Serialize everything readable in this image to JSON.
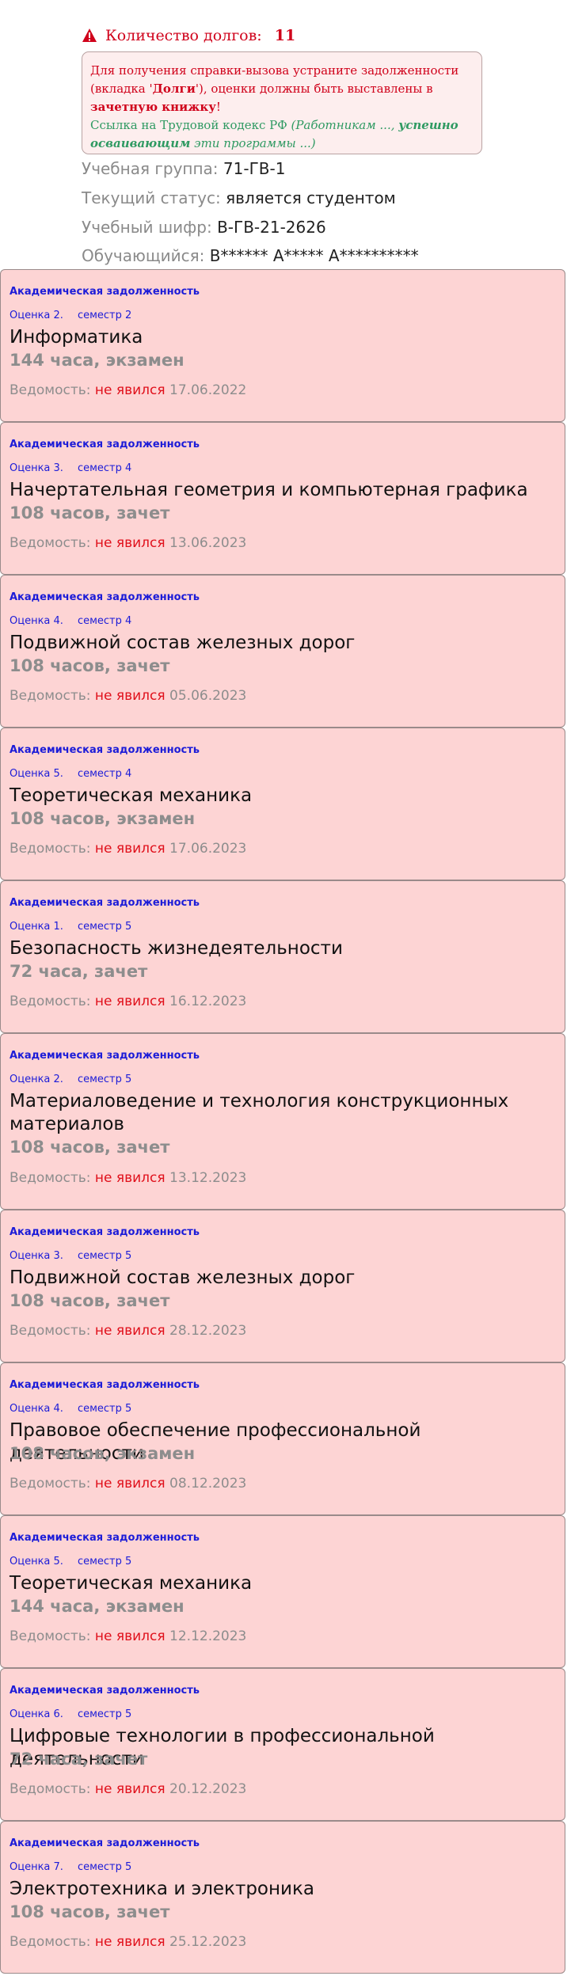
{
  "debts": {
    "label": "Количество долгов:",
    "count": "11"
  },
  "notice": {
    "line1": "Для получения справки-вызова устраните задолженности",
    "line2_pre": "(вкладка '",
    "line2_bold": "Долги",
    "line2_post": "'), оценки должны быть выставлены в",
    "line3_bold": "зачетную книжку",
    "line3_post": "!",
    "link_text": "Ссылка на Трудовой кодекс РФ",
    "italic1": "(Работникам ...,",
    "italic_bold": "успешно осваивающим",
    "italic2": "эти программы ...)"
  },
  "info": {
    "group_label": "Учебная группа:",
    "group_value": "71-ГВ-1",
    "status_label": "Текущий статус:",
    "status_value": "является студентом",
    "cipher_label": "Учебный шифр:",
    "cipher_value": "В-ГВ-21-2626",
    "student_label": "Обучающийся:",
    "student_value": "В****** А***** А**********"
  },
  "cards": [
    {
      "category": "Академическая задолженность",
      "grade": "Оценка 2.",
      "semester": "семестр 2",
      "subject": "Информатика",
      "hours": "144 часа, экзамен",
      "stmt_label": "Ведомость:",
      "stmt_status": "не явился",
      "stmt_date": "17.06.2022"
    },
    {
      "category": "Академическая задолженность",
      "grade": "Оценка 3.",
      "semester": "семестр 4",
      "subject": "Начертательная геометрия и компьютерная графика",
      "hours": "108 часов, зачет",
      "stmt_label": "Ведомость:",
      "stmt_status": "не явился",
      "stmt_date": "13.06.2023"
    },
    {
      "category": "Академическая задолженность",
      "grade": "Оценка 4.",
      "semester": "семестр 4",
      "subject": "Подвижной состав железных дорог",
      "hours": "108 часов, зачет",
      "stmt_label": "Ведомость:",
      "stmt_status": "не явился",
      "stmt_date": "05.06.2023"
    },
    {
      "category": "Академическая задолженность",
      "grade": "Оценка 5.",
      "semester": "семестр 4",
      "subject": "Теоретическая механика",
      "hours": "108 часов, экзамен",
      "stmt_label": "Ведомость:",
      "stmt_status": "не явился",
      "stmt_date": "17.06.2023"
    },
    {
      "category": "Академическая задолженность",
      "grade": "Оценка 1.",
      "semester": "семестр 5",
      "subject": "Безопасность жизнедеятельности",
      "hours": "72 часа, зачет",
      "stmt_label": "Ведомость:",
      "stmt_status": "не явился",
      "stmt_date": "16.12.2023"
    },
    {
      "category": "Академическая задолженность",
      "grade": "Оценка 2.",
      "semester": "семестр 5",
      "subject": "Материаловедение и технология конструкционных материалов",
      "hours": "108 часов, зачет",
      "stmt_label": "Ведомость:",
      "stmt_status": "не явился",
      "stmt_date": "13.12.2023"
    },
    {
      "category": "Академическая задолженность",
      "grade": "Оценка 3.",
      "semester": "семестр 5",
      "subject": "Подвижной состав железных дорог",
      "hours": "108 часов, зачет",
      "stmt_label": "Ведомость:",
      "stmt_status": "не явился",
      "stmt_date": "28.12.2023"
    },
    {
      "category": "Академическая задолженность",
      "grade": "Оценка 4.",
      "semester": "семестр 5",
      "subject": "Правовое обеспечение профессиональной деятельности",
      "hours": "108 часов, экзамен",
      "stmt_label": "Ведомость:",
      "stmt_status": "не явился",
      "stmt_date": "08.12.2023"
    },
    {
      "category": "Академическая задолженность",
      "grade": "Оценка 5.",
      "semester": "семестр 5",
      "subject": "Теоретическая механика",
      "hours": "144 часа, экзамен",
      "stmt_label": "Ведомость:",
      "stmt_status": "не явился",
      "stmt_date": "12.12.2023"
    },
    {
      "category": "Академическая задолженность",
      "grade": "Оценка 6.",
      "semester": "семестр 5",
      "subject": "Цифровые технологии в профессиональной деятельности",
      "hours": "72 часа, зачет",
      "stmt_label": "Ведомость:",
      "stmt_status": "не явился",
      "stmt_date": "20.12.2023"
    },
    {
      "category": "Академическая задолженность",
      "grade": "Оценка 7.",
      "semester": "семестр 5",
      "subject": "Электротехника и электроника",
      "hours": "108 часов, зачет",
      "stmt_label": "Ведомость:",
      "stmt_status": "не явился",
      "stmt_date": "25.12.2023"
    }
  ]
}
